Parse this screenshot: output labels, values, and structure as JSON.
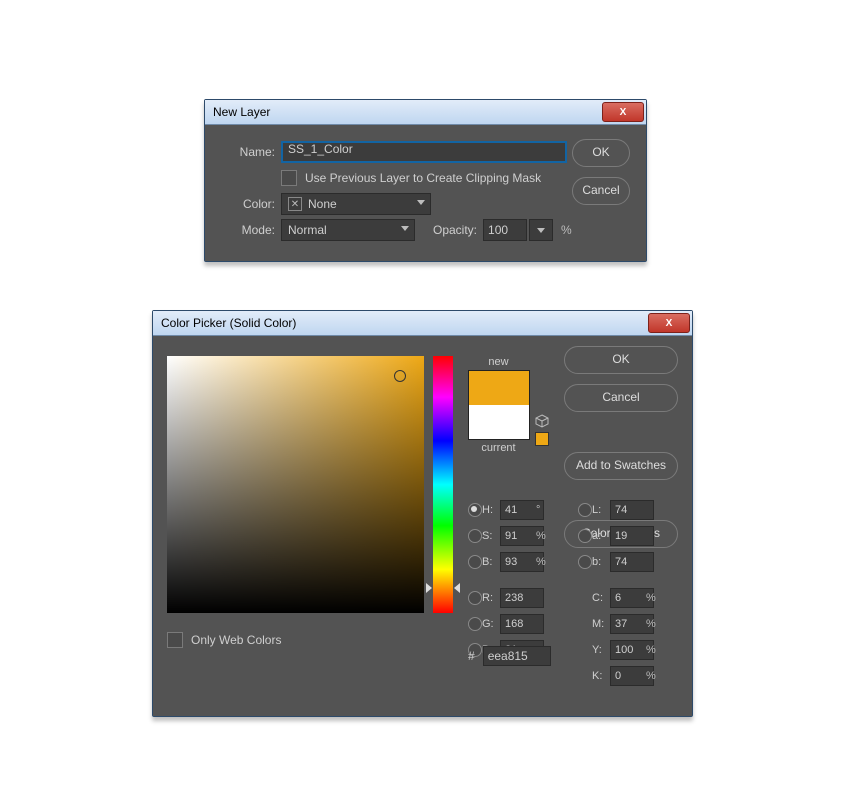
{
  "newLayer": {
    "title": "New Layer",
    "nameLbl": "Name:",
    "nameVal": "SS_1_Color",
    "prevMask": "Use Previous Layer to Create Clipping Mask",
    "colorLbl": "Color:",
    "colorVal": "None",
    "modeLbl": "Mode:",
    "modeVal": "Normal",
    "opacityLbl": "Opacity:",
    "opacityVal": "100",
    "pct": "%",
    "ok": "OK",
    "cancel": "Cancel"
  },
  "picker": {
    "title": "Color Picker (Solid Color)",
    "new": "new",
    "current": "current",
    "ok": "OK",
    "cancel": "Cancel",
    "addSwatches": "Add to Swatches",
    "libraries": "Color Libraries",
    "onlyWeb": "Only Web Colors",
    "HLab": "H:",
    "SValLab": "S:",
    "BrLab": "B:",
    "RLab": "R:",
    "GLab": "G:",
    "BLab": "B:",
    "LLab": "L:",
    "aLab": "a:",
    "bLab": "b:",
    "CLab": "C:",
    "MLab": "M:",
    "YLab": "Y:",
    "KLab": "K:",
    "deg": "°",
    "pct": "%",
    "h": "41",
    "s": "91",
    "br": "93",
    "r": "238",
    "g": "168",
    "bRGB": "21",
    "L": "74",
    "a": "19",
    "bLab2": "74",
    "c": "6",
    "m": "37",
    "y": "100",
    "k": "0",
    "hashLbl": "#",
    "hex": "eea815"
  }
}
